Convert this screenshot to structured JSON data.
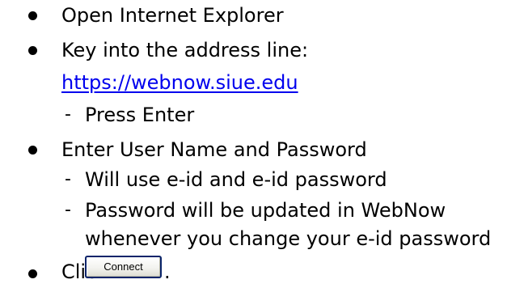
{
  "items": [
    {
      "text": "Open Internet Explorer"
    },
    {
      "text": "Key into the address line:",
      "link": "https://webnow.siue.edu",
      "subitems": [
        {
          "text": "Press Enter"
        }
      ]
    },
    {
      "text": "Enter User Name and Password",
      "subitems": [
        {
          "text": "Will use e-id and e-id password"
        },
        {
          "text": "Password will be updated in WebNow",
          "continuation": "whenever you change your e-id password"
        }
      ]
    },
    {
      "text": "Click",
      "button_label": "Connect",
      "trailing": "."
    }
  ],
  "dash_glyph": "-",
  "colors": {
    "link": "#0000ee",
    "text": "#000000",
    "button_border": "#0a246a"
  }
}
